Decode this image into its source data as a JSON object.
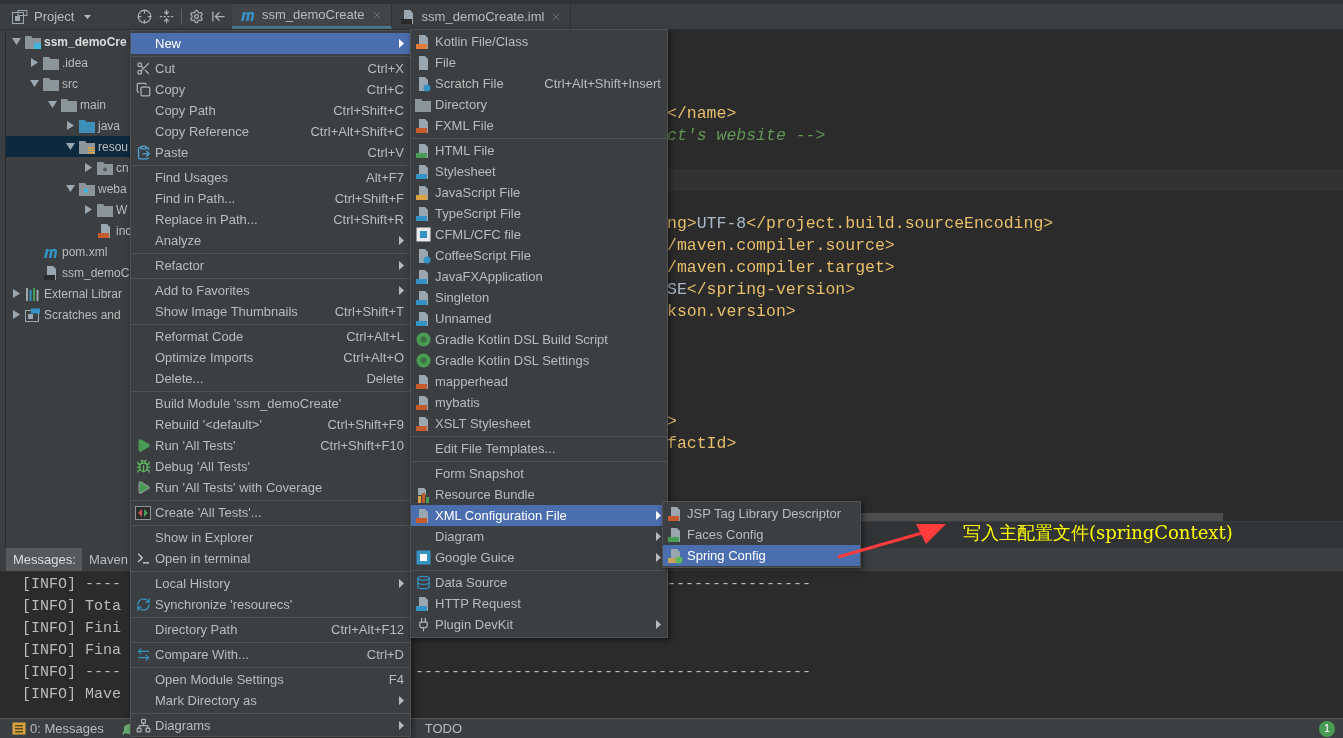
{
  "toolbar": {
    "project_label": "Project"
  },
  "editor_tabs": [
    {
      "label": "ssm_demoCreate",
      "selected": true
    },
    {
      "label": "ssm_demoCreate.iml",
      "selected": false
    }
  ],
  "project_tree": [
    {
      "label": "ssm_demoCre",
      "kind": "module",
      "expanded": true,
      "selected": false,
      "children": [
        {
          "label": ".idea",
          "kind": "folder",
          "expanded": false,
          "selected": false
        },
        {
          "label": "src",
          "kind": "folder",
          "expanded": true,
          "selected": false,
          "children": [
            {
              "label": "main",
              "kind": "folder",
              "expanded": true,
              "selected": false,
              "children": [
                {
                  "label": "java",
                  "kind": "source",
                  "expanded": false,
                  "selected": false
                },
                {
                  "label": "resou",
                  "kind": "resources",
                  "expanded": true,
                  "selected": true,
                  "children": [
                    {
                      "label": "cn",
                      "kind": "package",
                      "expanded": false,
                      "selected": false
                    }
                  ]
                },
                {
                  "label": "weba",
                  "kind": "web",
                  "expanded": true,
                  "selected": false,
                  "children": [
                    {
                      "label": "W",
                      "kind": "folder",
                      "expanded": false,
                      "selected": false
                    },
                    {
                      "label": "inc",
                      "kind": "jsp",
                      "selected": false
                    }
                  ]
                }
              ]
            }
          ]
        },
        {
          "label": "pom.xml",
          "kind": "maven",
          "selected": false
        },
        {
          "label": "ssm_demoC",
          "kind": "iml",
          "selected": false
        }
      ]
    },
    {
      "label": "External Librar",
      "kind": "libraries",
      "expanded": false,
      "selected": false
    },
    {
      "label": "Scratches and",
      "kind": "scratches",
      "expanded": false,
      "selected": false
    }
  ],
  "code_lines": [
    {
      "segments": [
        {
          "kind": "tag",
          "text": "</name>"
        }
      ]
    },
    {
      "segments": [
        {
          "kind": "comment",
          "text": "ct's website -->"
        }
      ]
    },
    {
      "segments": [
        {
          "kind": "tag",
          "text": "ng>"
        },
        {
          "kind": "text",
          "text": "UTF-8"
        },
        {
          "kind": "tag",
          "text": "</project.build.sourceEncoding>"
        }
      ]
    },
    {
      "segments": [
        {
          "kind": "tag",
          "text": "/maven.compiler.source>"
        }
      ]
    },
    {
      "segments": [
        {
          "kind": "tag",
          "text": "/maven.compiler.target>"
        }
      ]
    },
    {
      "segments": [
        {
          "kind": "text",
          "text": "SE"
        },
        {
          "kind": "tag",
          "text": "</spring-version>"
        }
      ]
    },
    {
      "segments": [
        {
          "kind": "tag",
          "text": "kson.version>"
        }
      ]
    },
    {
      "segments": [
        {
          "kind": "tag",
          "text": ">"
        }
      ]
    },
    {
      "segments": [
        {
          "kind": "tag",
          "text": "factId>"
        }
      ]
    }
  ],
  "context_menu": {
    "groups": [
      [
        {
          "label": "New",
          "submenu": true,
          "selected": true
        }
      ],
      [
        {
          "label": "Cut",
          "shortcut": "Ctrl+X",
          "submenu": false,
          "selected": false
        },
        {
          "label": "Copy",
          "shortcut": "Ctrl+C",
          "submenu": false,
          "selected": false
        },
        {
          "label": "Copy Path",
          "shortcut": "Ctrl+Shift+C",
          "submenu": false,
          "selected": false
        },
        {
          "label": "Copy Reference",
          "shortcut": "Ctrl+Alt+Shift+C",
          "submenu": false,
          "selected": false
        },
        {
          "label": "Paste",
          "shortcut": "Ctrl+V",
          "submenu": false,
          "selected": false
        }
      ],
      [
        {
          "label": "Find Usages",
          "shortcut": "Alt+F7",
          "submenu": false,
          "selected": false
        },
        {
          "label": "Find in Path...",
          "shortcut": "Ctrl+Shift+F",
          "submenu": false,
          "selected": false
        },
        {
          "label": "Replace in Path...",
          "shortcut": "Ctrl+Shift+R",
          "submenu": false,
          "selected": false
        },
        {
          "label": "Analyze",
          "submenu": true,
          "selected": false
        }
      ],
      [
        {
          "label": "Refactor",
          "submenu": true,
          "selected": false
        }
      ],
      [
        {
          "label": "Add to Favorites",
          "submenu": true,
          "selected": false
        },
        {
          "label": "Show Image Thumbnails",
          "shortcut": "Ctrl+Shift+T",
          "submenu": false,
          "selected": false
        }
      ],
      [
        {
          "label": "Reformat Code",
          "shortcut": "Ctrl+Alt+L",
          "submenu": false,
          "selected": false
        },
        {
          "label": "Optimize Imports",
          "shortcut": "Ctrl+Alt+O",
          "submenu": false,
          "selected": false
        },
        {
          "label": "Delete...",
          "shortcut": "Delete",
          "submenu": false,
          "selected": false
        }
      ],
      [
        {
          "label": "Build Module 'ssm_demoCreate'",
          "submenu": false,
          "selected": false
        },
        {
          "label": "Rebuild '<default>'",
          "shortcut": "Ctrl+Shift+F9",
          "submenu": false,
          "selected": false
        },
        {
          "label": "Run 'All Tests'",
          "shortcut": "Ctrl+Shift+F10",
          "submenu": false,
          "selected": false
        },
        {
          "label": "Debug 'All Tests'",
          "submenu": false,
          "selected": false
        },
        {
          "label": "Run 'All Tests' with Coverage",
          "submenu": false,
          "selected": false
        }
      ],
      [
        {
          "label": "Create 'All Tests'...",
          "submenu": false,
          "selected": false
        }
      ],
      [
        {
          "label": "Show in Explorer",
          "submenu": false,
          "selected": false
        },
        {
          "label": "Open in terminal",
          "submenu": false,
          "selected": false
        }
      ],
      [
        {
          "label": "Local History",
          "submenu": true,
          "selected": false
        },
        {
          "label": "Synchronize 'resourecs'",
          "submenu": false,
          "selected": false
        }
      ],
      [
        {
          "label": "Directory Path",
          "shortcut": "Ctrl+Alt+F12",
          "submenu": false,
          "selected": false
        }
      ],
      [
        {
          "label": "Compare With...",
          "shortcut": "Ctrl+D",
          "submenu": false,
          "selected": false
        }
      ],
      [
        {
          "label": "Open Module Settings",
          "shortcut": "F4",
          "submenu": false,
          "selected": false
        },
        {
          "label": "Mark Directory as",
          "submenu": true,
          "selected": false
        }
      ],
      [
        {
          "label": "Diagrams",
          "submenu": true,
          "selected": false
        }
      ]
    ]
  },
  "new_submenu": {
    "groups": [
      [
        {
          "label": "Kotlin File/Class",
          "submenu": false,
          "selected": false
        },
        {
          "label": "File",
          "submenu": false,
          "selected": false
        },
        {
          "label": "Scratch File",
          "shortcut": "Ctrl+Alt+Shift+Insert",
          "submenu": false,
          "selected": false
        },
        {
          "label": "Directory",
          "submenu": false,
          "selected": false
        },
        {
          "label": "FXML File",
          "submenu": false,
          "selected": false
        }
      ],
      [
        {
          "label": "HTML File",
          "submenu": false,
          "selected": false
        },
        {
          "label": "Stylesheet",
          "submenu": false,
          "selected": false
        },
        {
          "label": "JavaScript File",
          "submenu": false,
          "selected": false
        },
        {
          "label": "TypeScript File",
          "submenu": false,
          "selected": false
        },
        {
          "label": "CFML/CFC file",
          "submenu": false,
          "selected": false
        },
        {
          "label": "CoffeeScript File",
          "submenu": false,
          "selected": false
        },
        {
          "label": "JavaFXApplication",
          "submenu": false,
          "selected": false
        },
        {
          "label": "Singleton",
          "submenu": false,
          "selected": false
        },
        {
          "label": "Unnamed",
          "submenu": false,
          "selected": false
        },
        {
          "label": "Gradle Kotlin DSL Build Script",
          "submenu": false,
          "selected": false
        },
        {
          "label": "Gradle Kotlin DSL Settings",
          "submenu": false,
          "selected": false
        },
        {
          "label": "mapperhead",
          "submenu": false,
          "selected": false
        },
        {
          "label": "mybatis",
          "submenu": false,
          "selected": false
        },
        {
          "label": "XSLT Stylesheet",
          "submenu": false,
          "selected": false
        }
      ],
      [
        {
          "label": "Edit File Templates...",
          "submenu": false,
          "selected": false
        }
      ],
      [
        {
          "label": "Form Snapshot",
          "submenu": false,
          "selected": false
        },
        {
          "label": "Resource Bundle",
          "submenu": false,
          "selected": false
        },
        {
          "label": "XML Configuration File",
          "submenu": true,
          "selected": true
        },
        {
          "label": "Diagram",
          "submenu": true,
          "selected": false
        },
        {
          "label": "Google Guice",
          "submenu": true,
          "selected": false
        }
      ],
      [
        {
          "label": "Data Source",
          "submenu": false,
          "selected": false
        },
        {
          "label": "HTTP Request",
          "submenu": false,
          "selected": false
        },
        {
          "label": "Plugin DevKit",
          "submenu": true,
          "selected": false
        }
      ]
    ]
  },
  "xml_submenu": {
    "groups": [
      [
        {
          "label": "JSP Tag Library Descriptor",
          "submenu": false,
          "selected": false
        },
        {
          "label": "Faces Config",
          "submenu": false,
          "selected": false
        },
        {
          "label": "Spring Config",
          "submenu": false,
          "selected": true
        }
      ]
    ]
  },
  "bottom_panel": {
    "tabs": [
      {
        "label": "Messages:",
        "selected": true
      },
      {
        "label": "Maven",
        "selected": false
      }
    ],
    "console": [
      {
        "left": "[INFO] ----",
        "right": "----------------"
      },
      {
        "left": "[INFO] Tota"
      },
      {
        "left": "[INFO] Fini"
      },
      {
        "left": "[INFO] Fina"
      },
      {
        "left": "[INFO] ----",
        "right": "--------------------------------------------"
      },
      {
        "left": "[INFO] Mave"
      }
    ]
  },
  "status_bar": {
    "messages_label": "0: Messages",
    "todo_label": "TODO",
    "notification_count": "1"
  },
  "annotation": {
    "text": "写入主配置文件(springContext)"
  }
}
